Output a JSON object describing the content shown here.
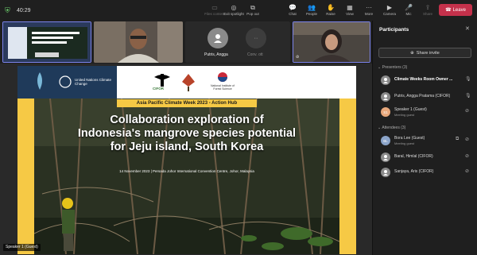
{
  "toolbar": {
    "timer": "40:29",
    "tools_left": [
      {
        "icon": "file-icon",
        "label": "Files content",
        "dim": true
      },
      {
        "icon": "spotlight-icon",
        "label": "Exit spotlight",
        "dim": false
      },
      {
        "icon": "popout-icon",
        "label": "Pop out",
        "dim": false
      }
    ],
    "tools_mid": [
      {
        "icon": "chat-icon",
        "label": "Chat"
      },
      {
        "icon": "people-icon",
        "label": "People"
      },
      {
        "icon": "raise-hand-icon",
        "label": "Raise"
      },
      {
        "icon": "view-icon",
        "label": "View"
      },
      {
        "icon": "more-icon",
        "label": "More"
      }
    ],
    "tools_right": [
      {
        "icon": "camera-icon",
        "label": "Camera"
      },
      {
        "icon": "mic-icon",
        "label": "Mic"
      },
      {
        "icon": "share-icon",
        "label": "Share"
      }
    ],
    "leave_label": "Leave"
  },
  "strip": {
    "tile3_name": "Putris, Angga",
    "tile3_extra": "Conv. ott"
  },
  "slide": {
    "banner": "Asia Pacific Climate Week 2023 - Action Hub",
    "title_line1": "Collaboration exploration of",
    "title_line2": "Indonesia's mangrove species potential",
    "title_line3": "for Jeju island, South Korea",
    "subline": "14 November 2023  |  Persada Johor International Convention Centre, Johor, Malaysia",
    "un_label": "United Nations Climate Change",
    "cifor_label": "CIFOR",
    "nifos_label": "National Institute of Forest Science",
    "speaker_tag": "Speaker 1 (Guest)"
  },
  "panel": {
    "title": "Participants",
    "share_label": "Share invite",
    "presenters_label": "Presenters (3)",
    "attendees_label": "Attendees (3)",
    "presenters": [
      {
        "name": "Climate Weeks Room Owner ...",
        "sub": "",
        "initials": "",
        "color": "#8a8a8a",
        "bold": true
      },
      {
        "name": "Putris, Angga Pratama (CIFOR)",
        "sub": "",
        "initials": "",
        "color": "#8a8a8a",
        "bold": false
      },
      {
        "name": "Speaker 1 (Guest)",
        "sub": "Meeting guest",
        "initials": "S1",
        "color": "#e8a87c",
        "bold": false
      }
    ],
    "attendees": [
      {
        "name": "Bora Lee (Guest)",
        "sub": "Meeting guest",
        "initials": "BL",
        "color": "#8ba4c9"
      },
      {
        "name": "Baral, Himlal (CIFOR)",
        "sub": "",
        "initials": "",
        "color": "#8a8a8a"
      },
      {
        "name": "Sanjaya, Aris (CIFOR)",
        "sub": "",
        "initials": "",
        "color": "#8a8a8a"
      }
    ]
  }
}
